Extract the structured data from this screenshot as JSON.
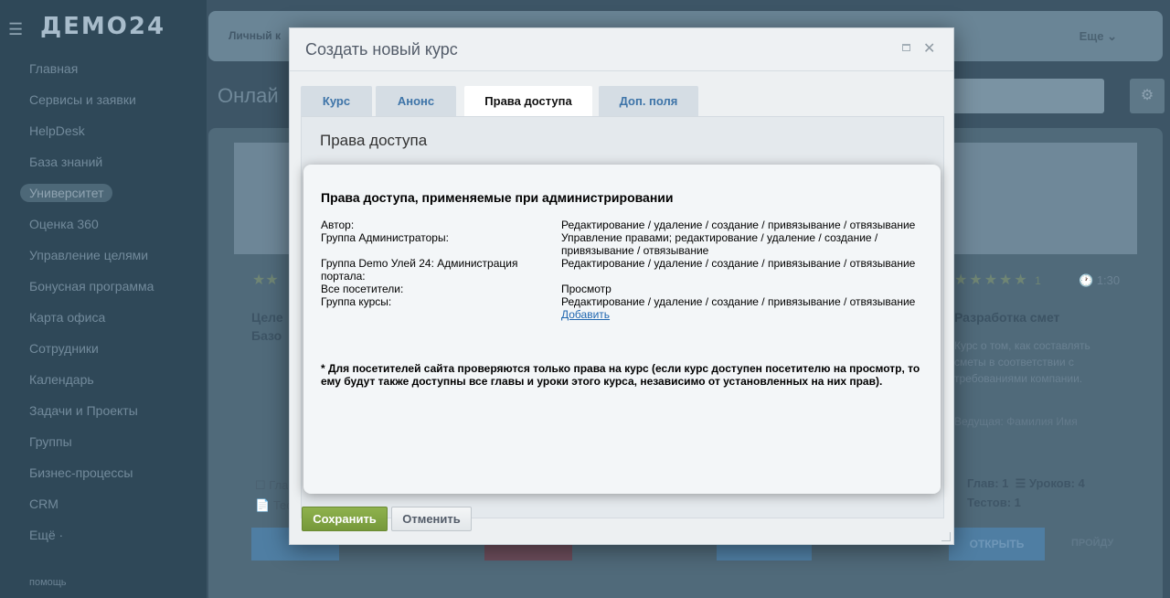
{
  "app": {
    "logo": "ДЕМО24",
    "nav": [
      "Главная",
      "Сервисы и заявки",
      "HelpDesk",
      "База знаний",
      "Университет",
      "Оценка 360",
      "Управление целями",
      "Бонусная программа",
      "Карта офиса",
      "Сотрудники",
      "Календарь",
      "Задачи и Проекты",
      "Группы",
      "Бизнес-процессы",
      "CRM",
      "Ещё ·"
    ],
    "help": "помощь",
    "topbar_left": "Личный к",
    "topbar_more": "Еще",
    "page_title": "Онлай",
    "card_left": {
      "title": "Целе\nБазо",
      "meta": [
        "Гла",
        "Тес"
      ]
    },
    "card_right": {
      "rating": "1",
      "time": "1:30",
      "title": "Разработка смет",
      "desc": "Курс о том, как составлять сметы в соответствии с требованиями компании.",
      "author": "Ведущая: Фамилия Имя",
      "meta_chapters": "Глав: 1",
      "meta_lessons": "Уроков: 4",
      "meta_tests": "Тестов: 1",
      "open": "ОТКРЫТЬ",
      "pass": "ПРОЙДУ"
    }
  },
  "dialog": {
    "title": "Создать новый курс",
    "tabs": [
      {
        "label": "Курс"
      },
      {
        "label": "Анонс"
      },
      {
        "label": "Права доступа",
        "active": true
      },
      {
        "label": "Доп. поля"
      }
    ],
    "panel_heading": "Права доступа",
    "save": "Сохранить",
    "cancel": "Отменить"
  },
  "popup": {
    "title": "Права доступа, применяемые при администрировании",
    "rights": [
      {
        "subject": "Автор:",
        "access": "Редактирование / удаление / создание / привязывание / отвязывание"
      },
      {
        "subject": "Группа Администраторы:",
        "access": "Управление правами; редактирование / удаление / создание / привязывание / отвязывание"
      },
      {
        "subject": "Группа Demo Улей 24: Администрация портала:",
        "access": "Редактирование / удаление / создание / привязывание / отвязывание"
      },
      {
        "subject": "Все посетители:",
        "access": "Просмотр"
      },
      {
        "subject": "Группа курсы:",
        "access": "Редактирование / удаление / создание / привязывание / отвязывание"
      }
    ],
    "add_link": "Добавить",
    "note": "* Для посетителей сайта проверяются только права на курс (если курс доступен посетителю на просмотр, то ему будут также доступны все главы и уроки этого курса, независимо от установленных на них прав)."
  }
}
